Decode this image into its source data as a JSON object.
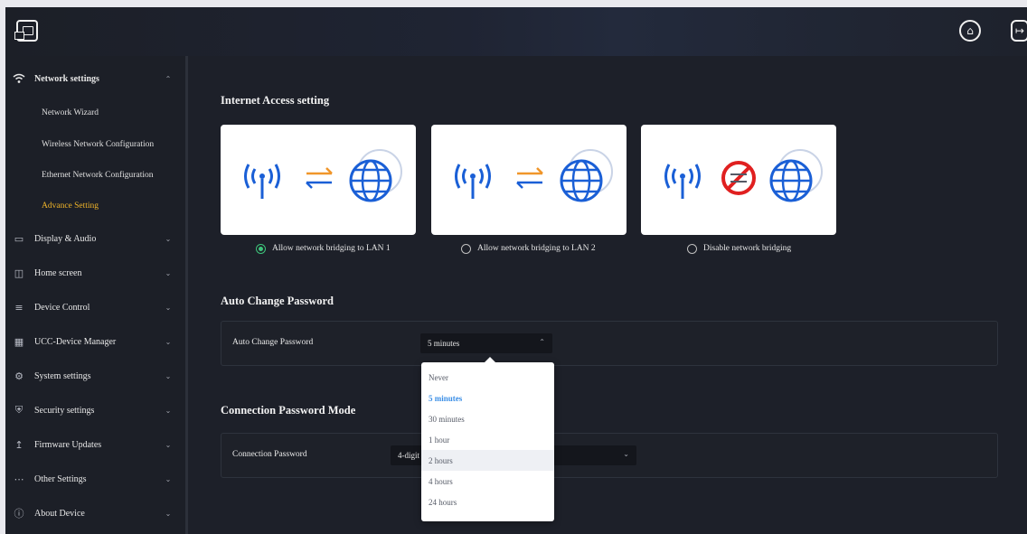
{
  "header": {
    "logo_icon": "screen-share-icon",
    "home_icon": "home-icon",
    "logout_icon": "logout-icon"
  },
  "sidebar": {
    "items": [
      {
        "label": "Network settings",
        "icon": "wifi-icon",
        "expanded": true
      },
      {
        "label": "Display & Audio",
        "icon": "monitor-icon"
      },
      {
        "label": "Home screen",
        "icon": "home-screen-icon"
      },
      {
        "label": "Device Control",
        "icon": "sliders-icon"
      },
      {
        "label": "UCC-Device Manager",
        "icon": "grid-icon"
      },
      {
        "label": "System settings",
        "icon": "gear-icon"
      },
      {
        "label": "Security settings",
        "icon": "shield-icon"
      },
      {
        "label": "Firmware Updates",
        "icon": "upload-icon"
      },
      {
        "label": "Other Settings",
        "icon": "more-icon"
      },
      {
        "label": "About Device",
        "icon": "info-icon"
      }
    ],
    "network_sub_items": [
      {
        "label": "Network Wizard"
      },
      {
        "label": "Wireless Network Configuration"
      },
      {
        "label": "Ethernet Network Configuration"
      },
      {
        "label": "Advance Setting",
        "active": true
      }
    ]
  },
  "internet_access": {
    "title": "Internet Access setting",
    "options": [
      {
        "label": "Allow network bridging to LAN 1",
        "checked": true
      },
      {
        "label": "Allow network bridging to LAN 2",
        "checked": false
      },
      {
        "label": "Disable network bridging",
        "checked": false
      }
    ]
  },
  "auto_change": {
    "title": "Auto Change Password",
    "field_label": "Auto Change Password",
    "value": "5 minutes",
    "options": [
      "Never",
      "5 minutes",
      "30 minutes",
      "1 hour",
      "2 hours",
      "4 hours",
      "24 hours"
    ],
    "selected_index": 1,
    "hover_index": 4
  },
  "connection_password": {
    "title": "Connection Password Mode",
    "field_label": "Connection Password",
    "value": "4-digit"
  },
  "colors": {
    "accent_active": "#f0b429",
    "radio_checked": "#3ec47b",
    "dropdown_selected": "#3a8ee6",
    "signal_blue": "#1a5fd6",
    "arrow_orange": "#f0962a",
    "prohibit_red": "#e02020"
  }
}
